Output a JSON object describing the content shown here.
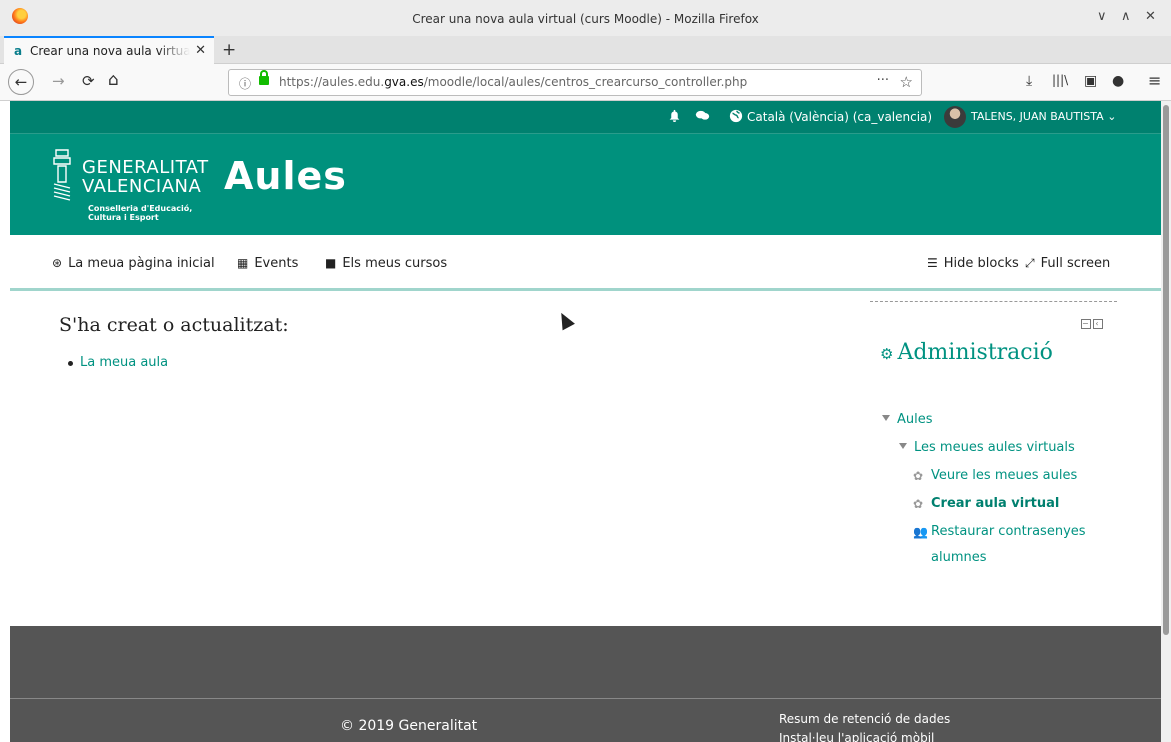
{
  "window": {
    "title": "Crear una nova aula virtual (curs Moodle) - Mozilla Firefox",
    "controls": {
      "minimize": "∨",
      "maximize": "∧",
      "close": "✕"
    }
  },
  "tab": {
    "label": "Crear una nova aula virtual",
    "close": "✕",
    "new_tab": "+"
  },
  "nav": {
    "back": "←",
    "forward": "→",
    "reload": "⟳",
    "home": "⌂",
    "url_prefix": "https://aules.edu.",
    "url_domain": "gva.es",
    "url_path": "/moodle/local/aules/centros_crearcurso_controller.php",
    "more": "···",
    "bookmark": "☆",
    "download": "⤓",
    "library": "|||\\",
    "sidebar": "▣",
    "account": "●",
    "menu": "≡"
  },
  "topbar": {
    "bell": "🔔",
    "messages": "💬",
    "globe": "🌐",
    "language": "Català (València) (ca_valencia)",
    "user": "TALENS, JUAN BAUTISTA",
    "user_caret": "⌄"
  },
  "brand": {
    "gva_line1": "GENERALITAT",
    "gva_line2": "VALENCIANA",
    "dept_line1": "Conselleria d'Educació,",
    "dept_line2": "Cultura i Esport",
    "product": "Aules"
  },
  "menu": {
    "home": "La meua pàgina inicial",
    "events": "Events",
    "courses": "Els meus cursos",
    "hide_blocks": "Hide blocks",
    "full_screen": "Full screen"
  },
  "main": {
    "title": "S'ha creat o actualitzat:",
    "results": [
      "La meua aula"
    ]
  },
  "admin_block": {
    "title": "Administració",
    "root": "Aules",
    "group": "Les meues aules virtuals",
    "items": [
      {
        "label": "Veure les meues aules"
      },
      {
        "label": "Crear aula virtual"
      },
      {
        "label": "Restaurar contrasenyes"
      }
    ],
    "items_wrap": "alumnes"
  },
  "footer": {
    "copyright": "© 2019 Generalitat",
    "data_retention": "Resum de retenció de dades",
    "mobile_app": "Instal·leu l'aplicació mòbil"
  }
}
